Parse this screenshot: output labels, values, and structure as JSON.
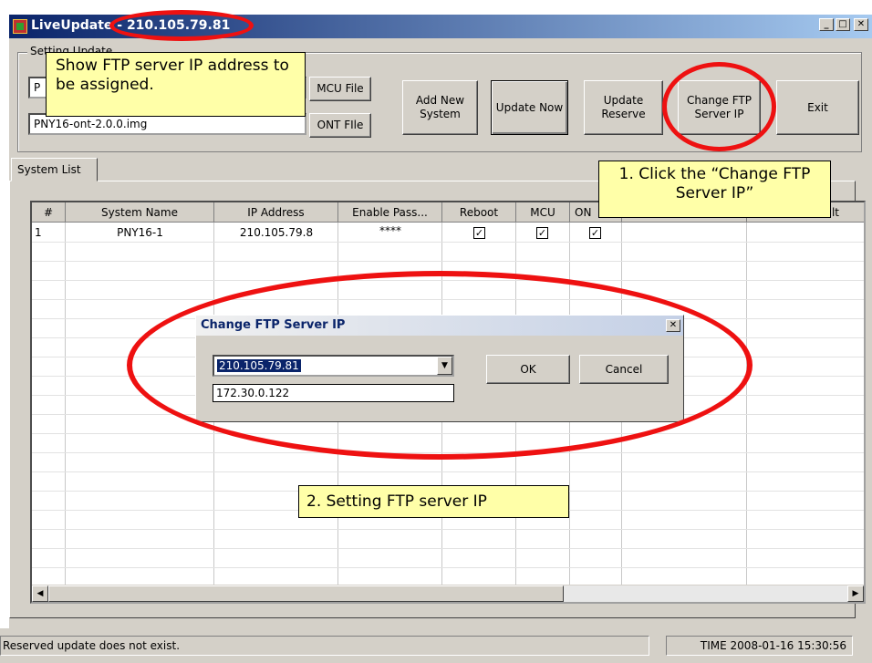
{
  "window": {
    "title": "LiveUpdate - 210.105.79.81",
    "controls": [
      "_",
      "□",
      "✕"
    ]
  },
  "settings": {
    "group_label": "Setting Update",
    "mcu_file_value": "P",
    "mcu_file_button": "MCU File",
    "ont_file_value": "PNY16-ont-2.0.0.img",
    "ont_file_button": "ONT FIle"
  },
  "toolbar": {
    "add_new_system": "Add New System",
    "update_now": "Update Now",
    "update_reserve": "Update Reserve",
    "change_ftp_server_ip": "Change FTP Server IP",
    "exit": "Exit"
  },
  "tabs": [
    {
      "label": "System List",
      "active": true
    }
  ],
  "grid": {
    "columns": [
      "#",
      "System Name",
      "IP Address",
      "Enable Pass...",
      "Reboot",
      "MCU",
      "ON",
      "",
      "lt"
    ],
    "rows": [
      {
        "num": "1",
        "system_name": "PNY16-1",
        "ip_address": "210.105.79.8",
        "enable_password": "****",
        "reboot": true,
        "mcu": true,
        "ont": true
      }
    ]
  },
  "dialog": {
    "title": "Change FTP Server IP",
    "selected_ip": "210.105.79.81",
    "dropdown_option": "172.30.0.122",
    "ok_label": "OK",
    "cancel_label": "Cancel"
  },
  "status": {
    "message": "Reserved update does not exist.",
    "time": "TIME 2008-01-16 15:30:56"
  },
  "annotations": {
    "callout_show_ip": "Show FTP server IP address to be assigned.",
    "callout_click": "1. Click the “Change FTP Server IP”",
    "callout_setting": "2. Setting FTP server IP",
    "highlight_color": "#ee1111",
    "callout_color": "#ffffa8"
  },
  "colors": {
    "titlebar_start": "#0a246a",
    "titlebar_end": "#a6caf0",
    "window_face": "#d4d0c8"
  }
}
